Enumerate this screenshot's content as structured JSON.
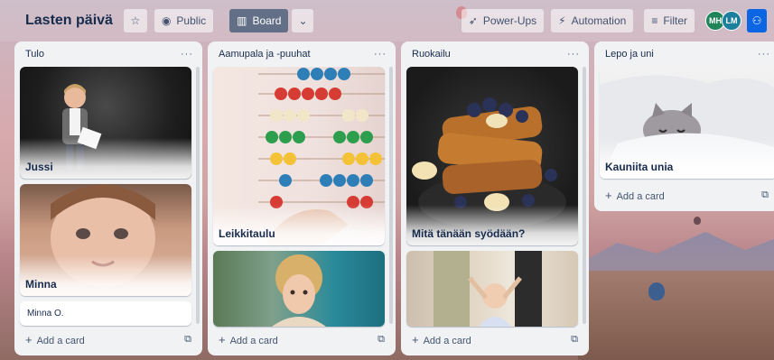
{
  "board": {
    "title": "Lasten päivä",
    "visibility_label": "Public",
    "view_label": "Board",
    "powerups_label": "Power-Ups",
    "automation_label": "Automation",
    "filter_label": "Filter",
    "members": [
      {
        "initials": "MH",
        "color": "#1f845a"
      },
      {
        "initials": "LM",
        "color": "#1d7f9e"
      }
    ]
  },
  "lists": [
    {
      "title": "Tulo",
      "cards": [
        {
          "label": "Jussi",
          "cover": "boy-reading"
        },
        {
          "label": "Minna",
          "cover": "baby-face"
        },
        {
          "label": "Minna O.",
          "cover": null
        }
      ]
    },
    {
      "title": "Aamupala ja -puuhat",
      "cards": [
        {
          "label": "Leikkitaulu",
          "cover": "abacus"
        },
        {
          "label": "",
          "cover": "child-curly-hair"
        }
      ]
    },
    {
      "title": "Ruokailu",
      "cards": [
        {
          "label": "Mitä tänään syödään?",
          "cover": "french-toast"
        },
        {
          "label": "",
          "cover": "baby-walking"
        }
      ]
    },
    {
      "title": "Lepo ja uni",
      "cards": [
        {
          "label": "Kauniita unia",
          "cover": "kitten-blanket"
        }
      ]
    }
  ],
  "add_card_label": "Add a card",
  "list_menu_glyph": "···",
  "icons": {
    "star": "star-icon",
    "globe": "globe-icon",
    "board": "board-icon",
    "chevron": "chevron-down-icon",
    "powerups": "rocket-icon",
    "automation": "bolt-icon",
    "filter": "filter-icon",
    "share": "share-icon",
    "template": "card-template-icon"
  }
}
